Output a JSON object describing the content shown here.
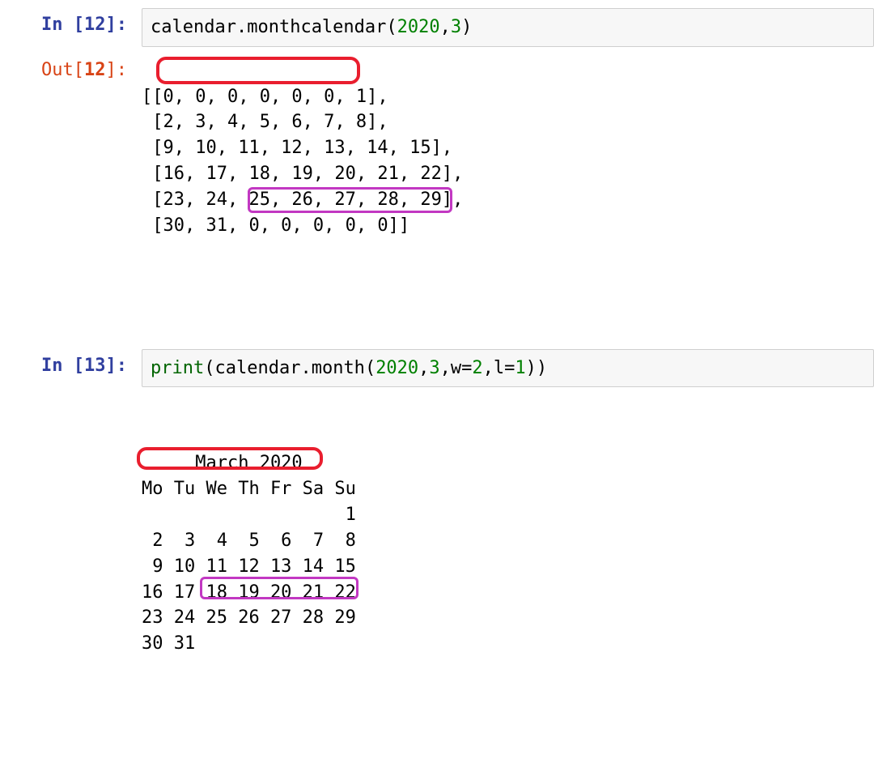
{
  "cells": {
    "in12": {
      "prompt_prefix": "In [",
      "prompt_num": "12",
      "prompt_suffix": "]:",
      "code_parts": {
        "obj": "calendar",
        "dot": ".",
        "fn": "monthcalendar",
        "lp": "(",
        "arg1": "2020",
        "comma": ",",
        "arg2": "3",
        "rp": ")"
      }
    },
    "out12": {
      "prompt_prefix": "Out[",
      "prompt_num": "12",
      "prompt_suffix": "]:",
      "lines": [
        "[[0, 0, 0, 0, 0, 0, 1],",
        " [2, 3, 4, 5, 6, 7, 8],",
        " [9, 10, 11, 12, 13, 14, 15],",
        " [16, 17, 18, 19, 20, 21, 22],",
        " [23, 24, 25, 26, 27, 28, 29],",
        " [30, 31, 0, 0, 0, 0, 0]]"
      ]
    },
    "in13": {
      "prompt_prefix": "In [",
      "prompt_num": "13",
      "prompt_suffix": "]:",
      "code_parts": {
        "print": "print",
        "lp": "(",
        "obj": "calendar",
        "dot": ".",
        "fn": "month",
        "lp2": "(",
        "arg1": "2020",
        "c1": ",",
        "arg2": "3",
        "c2": ",",
        "pw": "w",
        "eq1": "=",
        "vw": "2",
        "c3": ",",
        "pl": "l",
        "eq2": "=",
        "vl": "1",
        "rp2": ")",
        "rp": ")"
      }
    },
    "out13": {
      "calendar_text": "     March 2020\nMo Tu We Th Fr Sa Su\n                   1\n 2  3  4  5  6  7  8\n 9 10 11 12 13 14 15\n16 17 18 19 20 21 22\n23 24 25 26 27 28 29\n30 31"
    }
  }
}
